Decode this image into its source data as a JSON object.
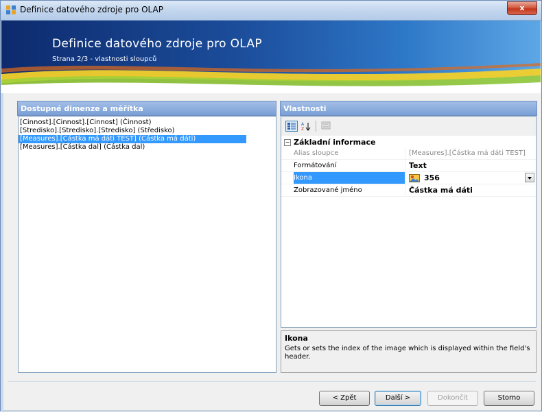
{
  "window": {
    "title": "Definice datového zdroje pro OLAP",
    "close_label": "x"
  },
  "banner": {
    "title": "Definice datového zdroje pro OLAP",
    "subtitle": "Strana 2/3 - vlastnosti sloupců"
  },
  "left_pane": {
    "header": "Dostupné dimenze a měřítka",
    "items": [
      {
        "label": "[Cinnost].[Cinnost].[Cinnost] (Činnost)",
        "selected": false
      },
      {
        "label": "[Stredisko].[Stredisko].[Stredisko] (Středisko)",
        "selected": false
      },
      {
        "label": "[Measures].[Částka má dáti TEST] (Částka má dáti)",
        "selected": true
      },
      {
        "label": "[Measures].[Částka dal] (Částka dal)",
        "selected": false
      }
    ]
  },
  "right_pane": {
    "header": "Vlastnosti",
    "toolbar": {
      "categorized_icon": "categorized-icon",
      "alphabetical_icon": "sort-az-icon",
      "property_pages_icon": "property-pages-icon"
    },
    "category": {
      "toggle": "−",
      "label": "Základní informace"
    },
    "properties": [
      {
        "name": "Alias sloupce",
        "value": "[Measures].[Částka má dáti TEST]",
        "style": "gray"
      },
      {
        "name": "Formátování",
        "value": "Text",
        "style": "bold"
      },
      {
        "name": "Ikona",
        "value": "356",
        "style": "bold",
        "selected": true
      },
      {
        "name": "Zobrazované jméno",
        "value": "Částka má dáti",
        "style": "bold"
      }
    ],
    "description": {
      "title": "Ikona",
      "text": "Gets or sets the index of the image which is displayed within the field's header."
    }
  },
  "buttons": {
    "back": "< Zpět",
    "next": "Další >",
    "finish": "Dokončit",
    "cancel": "Storno"
  },
  "colors": {
    "selection": "#3399ff",
    "header_blue": "#7a9fd6",
    "banner_dark": "#0d2a6d"
  }
}
